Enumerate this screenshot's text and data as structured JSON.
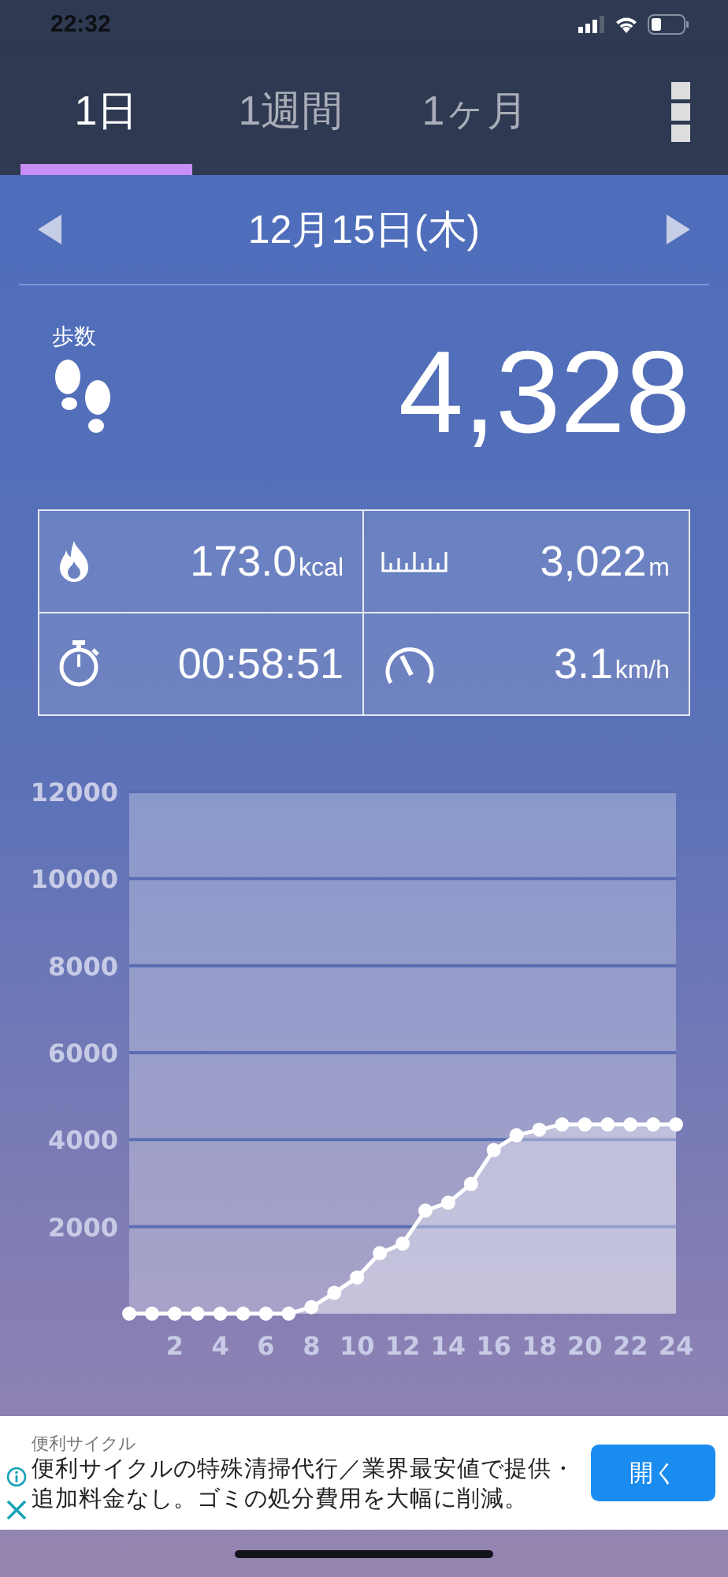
{
  "status_bar": {
    "time": "22:32"
  },
  "tabs": [
    {
      "label": "1日",
      "selected": true
    },
    {
      "label": "1週間",
      "selected": false
    },
    {
      "label": "1ヶ月",
      "selected": false
    }
  ],
  "date_nav": {
    "date": "12月15日(木)"
  },
  "steps": {
    "label": "歩数",
    "value": "4,328"
  },
  "stats": [
    {
      "kind": "calories",
      "value": "173.0",
      "unit": "kcal"
    },
    {
      "kind": "distance",
      "value": "3,022",
      "unit": "m"
    },
    {
      "kind": "time",
      "value": "00:58:51"
    },
    {
      "kind": "speed",
      "value": "3.1",
      "unit": "km/h"
    }
  ],
  "chart_data": {
    "type": "area",
    "x": [
      0,
      1,
      2,
      3,
      4,
      5,
      6,
      7,
      8,
      9,
      10,
      11,
      12,
      13,
      14,
      15,
      16,
      17,
      18,
      19,
      20,
      21,
      22,
      23,
      24
    ],
    "series": [
      {
        "color": "#ffffff",
        "values": [
          0,
          0,
          0,
          0,
          0,
          0,
          0,
          0,
          150,
          480,
          830,
          1390,
          1610,
          2370,
          2550,
          2980,
          3760,
          4100,
          4230,
          4350,
          4350,
          4350,
          4350,
          4350,
          4350
        ]
      }
    ],
    "grid": true,
    "xlim": [
      0,
      24
    ],
    "ylim": [
      0,
      12000
    ],
    "xticks": [
      2,
      4,
      6,
      8,
      10,
      12,
      14,
      16,
      18,
      20,
      22,
      24
    ],
    "yticks": [
      2000,
      4000,
      6000,
      8000,
      10000,
      12000
    ]
  },
  "ad": {
    "advertiser": "便利サイクル",
    "text": "便利サイクルの特殊清掃代行／業界最安値で提供・追加料金なし。ゴミの処分費用を大幅に削減。",
    "button": "開く"
  }
}
